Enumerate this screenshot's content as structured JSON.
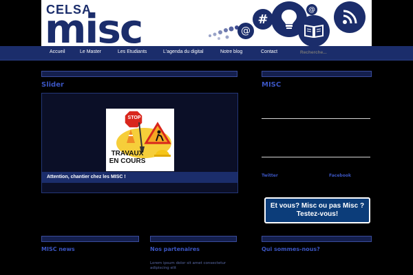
{
  "header": {
    "brand_top": "CELSA",
    "brand_main": "misc",
    "icons": [
      "dots-icon",
      "at-icon",
      "hashtag-icon",
      "lightbulb-icon",
      "book-icon",
      "rss-icon"
    ]
  },
  "nav": {
    "items": [
      {
        "label": "Accueil"
      },
      {
        "label": "Le Master"
      },
      {
        "label": "Les Etudiants"
      },
      {
        "label": "L'agenda du digital"
      },
      {
        "label": "Notre blog"
      },
      {
        "label": "Contact"
      }
    ],
    "search_placeholder": "Recherche..."
  },
  "main": {
    "section_heading": "Slider",
    "slider": {
      "image_sign_text": "TRAVAUX EN COURS",
      "stop_text": "STOP",
      "caption": "Attention, chantier chez les MISC !"
    }
  },
  "sidebar": {
    "heading": "MISC",
    "link_left": "Twitter",
    "link_right": "Facebook",
    "quiz_line1": "Et vous? Misc ou pas Misc ?",
    "quiz_line2": "Testez-vous!"
  },
  "bottom": {
    "col1_heading": "MISC news",
    "col2_heading": "Nos partenaires",
    "col2_text": "Lorem ipsum dolor sit amet consectetur adipiscing elit",
    "col3_heading": "Qui sommes-nous?"
  },
  "colors": {
    "brand_navy": "#1b2d6b",
    "heading_blue": "#3b55c2",
    "quiz_blue": "#0c3d7a"
  }
}
